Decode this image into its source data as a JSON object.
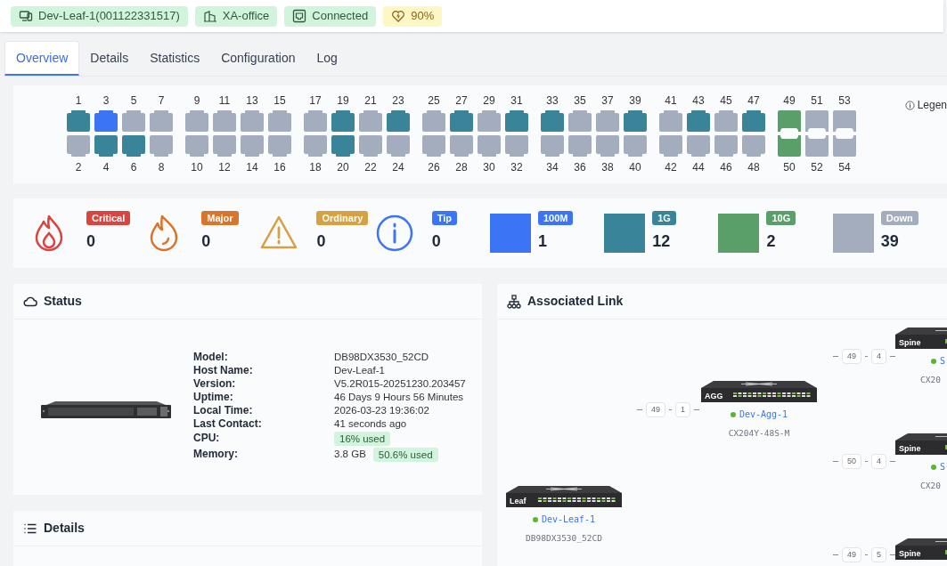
{
  "header": {
    "badges": [
      {
        "kind": "device",
        "label": "Dev-Leaf-1(001122331517)"
      },
      {
        "kind": "site",
        "label": "XA-office"
      },
      {
        "kind": "connection",
        "label": "Connected"
      },
      {
        "kind": "health",
        "label": "90%"
      }
    ]
  },
  "tabs": [
    {
      "label": "Overview",
      "selected": true
    },
    {
      "label": "Details",
      "selected": false
    },
    {
      "label": "Statistics",
      "selected": false
    },
    {
      "label": "Configuration",
      "selected": false
    },
    {
      "label": "Log",
      "selected": false
    }
  ],
  "ports": {
    "legend": "Legen",
    "groups": [
      {
        "kind": "rj45",
        "columns": [
          {
            "top": {
              "number": "1",
              "color": "#3a8499"
            },
            "bottom": {
              "number": "2",
              "color": "#a3adbd"
            }
          },
          {
            "top": {
              "number": "3",
              "color": "#3b74f5"
            },
            "bottom": {
              "number": "4",
              "color": "#3a8499"
            }
          },
          {
            "top": {
              "number": "5",
              "color": "#a3adbd"
            },
            "bottom": {
              "number": "6",
              "color": "#3a8499"
            }
          },
          {
            "top": {
              "number": "7",
              "color": "#a3adbd"
            },
            "bottom": {
              "number": "8",
              "color": "#a3adbd"
            }
          }
        ]
      },
      {
        "kind": "rj45",
        "columns": [
          {
            "top": {
              "number": "9",
              "color": "#a3adbd"
            },
            "bottom": {
              "number": "10",
              "color": "#a3adbd"
            }
          },
          {
            "top": {
              "number": "11",
              "color": "#a3adbd"
            },
            "bottom": {
              "number": "12",
              "color": "#a3adbd"
            }
          },
          {
            "top": {
              "number": "13",
              "color": "#a3adbd"
            },
            "bottom": {
              "number": "14",
              "color": "#a3adbd"
            }
          },
          {
            "top": {
              "number": "15",
              "color": "#a3adbd"
            },
            "bottom": {
              "number": "16",
              "color": "#a3adbd"
            }
          }
        ]
      },
      {
        "kind": "rj45",
        "columns": [
          {
            "top": {
              "number": "17",
              "color": "#a3adbd"
            },
            "bottom": {
              "number": "18",
              "color": "#a3adbd"
            }
          },
          {
            "top": {
              "number": "19",
              "color": "#3a8499"
            },
            "bottom": {
              "number": "20",
              "color": "#3a8499"
            }
          },
          {
            "top": {
              "number": "21",
              "color": "#a3adbd"
            },
            "bottom": {
              "number": "22",
              "color": "#a3adbd"
            }
          },
          {
            "top": {
              "number": "23",
              "color": "#3a8499"
            },
            "bottom": {
              "number": "24",
              "color": "#a3adbd"
            }
          }
        ]
      },
      {
        "kind": "rj45",
        "columns": [
          {
            "top": {
              "number": "25",
              "color": "#a3adbd"
            },
            "bottom": {
              "number": "26",
              "color": "#a3adbd"
            }
          },
          {
            "top": {
              "number": "27",
              "color": "#3a8499"
            },
            "bottom": {
              "number": "28",
              "color": "#a3adbd"
            }
          },
          {
            "top": {
              "number": "29",
              "color": "#a3adbd"
            },
            "bottom": {
              "number": "30",
              "color": "#a3adbd"
            }
          },
          {
            "top": {
              "number": "31",
              "color": "#3a8499"
            },
            "bottom": {
              "number": "32",
              "color": "#a3adbd"
            }
          }
        ]
      },
      {
        "kind": "rj45",
        "columns": [
          {
            "top": {
              "number": "33",
              "color": "#3a8499"
            },
            "bottom": {
              "number": "34",
              "color": "#a3adbd"
            }
          },
          {
            "top": {
              "number": "35",
              "color": "#a3adbd"
            },
            "bottom": {
              "number": "36",
              "color": "#a3adbd"
            }
          },
          {
            "top": {
              "number": "37",
              "color": "#a3adbd"
            },
            "bottom": {
              "number": "38",
              "color": "#a3adbd"
            }
          },
          {
            "top": {
              "number": "39",
              "color": "#3a8499"
            },
            "bottom": {
              "number": "40",
              "color": "#a3adbd"
            }
          }
        ]
      },
      {
        "kind": "rj45",
        "columns": [
          {
            "top": {
              "number": "41",
              "color": "#a3adbd"
            },
            "bottom": {
              "number": "42",
              "color": "#a3adbd"
            }
          },
          {
            "top": {
              "number": "43",
              "color": "#3a8499"
            },
            "bottom": {
              "number": "44",
              "color": "#a3adbd"
            }
          },
          {
            "top": {
              "number": "45",
              "color": "#a3adbd"
            },
            "bottom": {
              "number": "46",
              "color": "#a3adbd"
            }
          },
          {
            "top": {
              "number": "47",
              "color": "#3a8499"
            },
            "bottom": {
              "number": "48",
              "color": "#a3adbd"
            }
          }
        ]
      },
      {
        "kind": "sfp",
        "columns": [
          {
            "top": {
              "number": "49",
              "color": "#5a9e6a"
            },
            "bottom": {
              "number": "50",
              "color": "#5a9e6a"
            }
          },
          {
            "top": {
              "number": "51",
              "color": "#a3adbd"
            },
            "bottom": {
              "number": "52",
              "color": "#a3adbd"
            }
          },
          {
            "top": {
              "number": "53",
              "color": "#a3adbd"
            },
            "bottom": {
              "number": "54",
              "color": "#a3adbd"
            }
          }
        ]
      }
    ]
  },
  "alarms": [
    {
      "kind": "critical",
      "label": "Critical",
      "count": "0"
    },
    {
      "kind": "major",
      "label": "Major",
      "count": "0"
    },
    {
      "kind": "ordinary",
      "label": "Ordinary",
      "count": "0"
    },
    {
      "kind": "tip",
      "label": "Tip",
      "count": "0"
    }
  ],
  "port_speeds": [
    {
      "label": "100M",
      "count": "1",
      "color": "#3b74f5"
    },
    {
      "label": "1G",
      "count": "12",
      "color": "#3a8499"
    },
    {
      "label": "10G",
      "count": "2",
      "color": "#5a9e6a"
    },
    {
      "label": "Down",
      "count": "39",
      "color": "#a3adbd"
    }
  ],
  "status": {
    "title": "Status",
    "rows": [
      {
        "label": "Model:",
        "value": "DB98DX3530_52CD"
      },
      {
        "label": "Host Name:",
        "value": "Dev-Leaf-1"
      },
      {
        "label": "Version:",
        "value": "V5.2R015-20251230.203457"
      },
      {
        "label": "Uptime:",
        "value": "46 Days 9 Hours 56 Minutes"
      },
      {
        "label": "Local Time:",
        "value": "2026-03-23 19:36:02"
      },
      {
        "label": "Last Contact:",
        "value": "41 seconds ago"
      },
      {
        "label": "CPU:",
        "badge": "16% used"
      },
      {
        "label": "Memory:",
        "value": "3.8 GB",
        "badge": "50.6% used"
      }
    ]
  },
  "details": {
    "title": "Details"
  },
  "associated_link": {
    "title": "Associated Link",
    "nodes": [
      {
        "role": "Leaf",
        "name": "Dev-Leaf-1",
        "model": "DB98DX3530_52CD",
        "online": true
      },
      {
        "role": "AGG",
        "name": "Dev-Agg-1",
        "model": "CX204Y-48S-M",
        "online": true
      },
      {
        "role": "Spine",
        "name": "S",
        "model": "CX20",
        "online": true
      },
      {
        "role": "Spine",
        "name": "S",
        "model": "CX20",
        "online": true
      },
      {
        "role": "Spine"
      }
    ],
    "links": [
      {
        "ports": [
          "49",
          "1"
        ]
      },
      {
        "ports": [
          "49",
          "4"
        ]
      },
      {
        "ports": [
          "50",
          "4"
        ]
      },
      {
        "ports": [
          "49",
          "5"
        ]
      }
    ]
  }
}
